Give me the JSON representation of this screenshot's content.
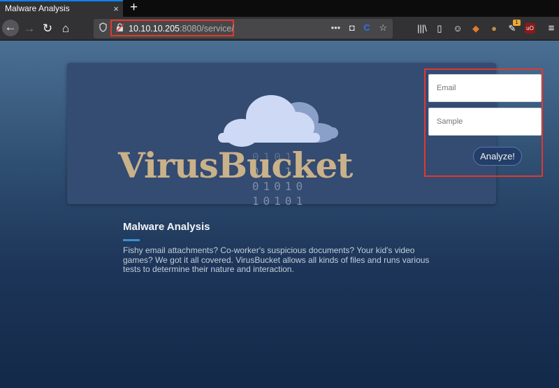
{
  "browser": {
    "tab_title": "Malware Analysis",
    "tab_close": "×",
    "new_tab": "+",
    "url_host": "10.10.10.205",
    "url_rest": ":8080/service/",
    "nav_back": "←",
    "nav_forward": "→",
    "nav_reload": "↻",
    "nav_home": "⌂",
    "url_menu": "•••",
    "toolbar_icons": [
      "library-icon",
      "sidebar-icon",
      "account-icon",
      "extension-fox-icon",
      "cookie-icon",
      "extension-badge-icon",
      "ublock-icon",
      "menu-icon"
    ],
    "badge_count": "1",
    "ublock_label": "uO",
    "menu_glyph": "≡"
  },
  "hero": {
    "brand": "VirusBucket",
    "binary": [
      "01010",
      "01010",
      "01010",
      "10101"
    ]
  },
  "form": {
    "email_placeholder": "Email",
    "sample_placeholder": "Sample",
    "submit_label": "Analyze!"
  },
  "section": {
    "title": "Malware Analysis",
    "description": "Fishy email attachments? Co-worker's suspicious documents? Your kid's video games? We got it all covered. VirusBucket allows all kinds of files and runs various tests to determine their nature and interaction."
  },
  "colors": {
    "accent": "#3b8fd6",
    "brand": "#c9b189",
    "highlight": "#e2382d",
    "hero_bg": "#344b72"
  }
}
